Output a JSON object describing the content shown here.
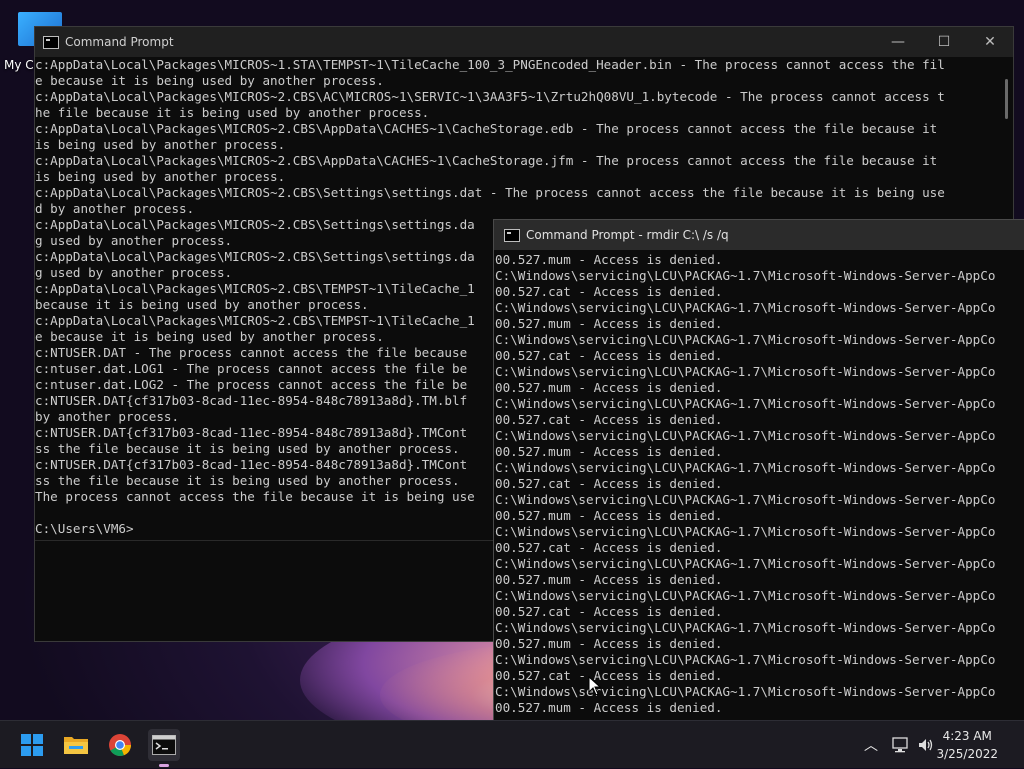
{
  "desktop": {
    "icon_label": "My Co"
  },
  "window_back": {
    "title": "Command Prompt",
    "controls": {
      "minimize": "—",
      "maximize": "☐",
      "close": "✕"
    },
    "lines": [
      "c:AppData\\Local\\Packages\\MICROS~1.STA\\TEMPST~1\\TileCache_100_3_PNGEncoded_Header.bin - The process cannot access the fil",
      "e because it is being used by another process.",
      "c:AppData\\Local\\Packages\\MICROS~2.CBS\\AC\\MICROS~1\\SERVIC~1\\3AA3F5~1\\Zrtu2hQ08VU_1.bytecode - The process cannot access t",
      "he file because it is being used by another process.",
      "c:AppData\\Local\\Packages\\MICROS~2.CBS\\AppData\\CACHES~1\\CacheStorage.edb - The process cannot access the file because it",
      "is being used by another process.",
      "c:AppData\\Local\\Packages\\MICROS~2.CBS\\AppData\\CACHES~1\\CacheStorage.jfm - The process cannot access the file because it",
      "is being used by another process.",
      "c:AppData\\Local\\Packages\\MICROS~2.CBS\\Settings\\settings.dat - The process cannot access the file because it is being use",
      "d by another process.",
      "c:AppData\\Local\\Packages\\MICROS~2.CBS\\Settings\\settings.da",
      "g used by another process.",
      "c:AppData\\Local\\Packages\\MICROS~2.CBS\\Settings\\settings.da",
      "g used by another process.",
      "c:AppData\\Local\\Packages\\MICROS~2.CBS\\TEMPST~1\\TileCache_1",
      "because it is being used by another process.",
      "c:AppData\\Local\\Packages\\MICROS~2.CBS\\TEMPST~1\\TileCache_1",
      "e because it is being used by another process.",
      "c:NTUSER.DAT - The process cannot access the file because",
      "c:ntuser.dat.LOG1 - The process cannot access the file be",
      "c:ntuser.dat.LOG2 - The process cannot access the file be",
      "c:NTUSER.DAT{cf317b03-8cad-11ec-8954-848c78913a8d}.TM.blf",
      "by another process.",
      "c:NTUSER.DAT{cf317b03-8cad-11ec-8954-848c78913a8d}.TMCont",
      "ss the file because it is being used by another process.",
      "c:NTUSER.DAT{cf317b03-8cad-11ec-8954-848c78913a8d}.TMCont",
      "ss the file because it is being used by another process.",
      "The process cannot access the file because it is being use",
      "",
      "C:\\Users\\VM6>"
    ]
  },
  "window_front": {
    "title": "Command Prompt - rmdir  C:\\ /s /q",
    "lines": [
      "00.527.mum - Access is denied.",
      "C:\\Windows\\servicing\\LCU\\PACKAG~1.7\\Microsoft-Windows-Server-AppCo",
      "00.527.cat - Access is denied.",
      "C:\\Windows\\servicing\\LCU\\PACKAG~1.7\\Microsoft-Windows-Server-AppCo",
      "00.527.mum - Access is denied.",
      "C:\\Windows\\servicing\\LCU\\PACKAG~1.7\\Microsoft-Windows-Server-AppCo",
      "00.527.cat - Access is denied.",
      "C:\\Windows\\servicing\\LCU\\PACKAG~1.7\\Microsoft-Windows-Server-AppCo",
      "00.527.mum - Access is denied.",
      "C:\\Windows\\servicing\\LCU\\PACKAG~1.7\\Microsoft-Windows-Server-AppCo",
      "00.527.cat - Access is denied.",
      "C:\\Windows\\servicing\\LCU\\PACKAG~1.7\\Microsoft-Windows-Server-AppCo",
      "00.527.mum - Access is denied.",
      "C:\\Windows\\servicing\\LCU\\PACKAG~1.7\\Microsoft-Windows-Server-AppCo",
      "00.527.cat - Access is denied.",
      "C:\\Windows\\servicing\\LCU\\PACKAG~1.7\\Microsoft-Windows-Server-AppCo",
      "00.527.mum - Access is denied.",
      "C:\\Windows\\servicing\\LCU\\PACKAG~1.7\\Microsoft-Windows-Server-AppCo",
      "00.527.cat - Access is denied.",
      "C:\\Windows\\servicing\\LCU\\PACKAG~1.7\\Microsoft-Windows-Server-AppCo",
      "00.527.mum - Access is denied.",
      "C:\\Windows\\servicing\\LCU\\PACKAG~1.7\\Microsoft-Windows-Server-AppCo",
      "00.527.cat - Access is denied.",
      "C:\\Windows\\servicing\\LCU\\PACKAG~1.7\\Microsoft-Windows-Server-AppCo",
      "00.527.mum - Access is denied.",
      "C:\\Windows\\servicing\\LCU\\PACKAG~1.7\\Microsoft-Windows-Server-AppCo",
      "00.527.cat - Access is denied.",
      "C:\\Windows\\servicing\\LCU\\PACKAG~1.7\\Microsoft-Windows-Server-AppCo",
      "00.527.mum - Access is denied."
    ]
  },
  "taskbar": {
    "icons": [
      "start-icon",
      "file-explorer-icon",
      "chrome-icon",
      "command-prompt-icon"
    ],
    "tray_chevron": "︿",
    "time": "4:23 AM",
    "date": "3/25/2022"
  },
  "colors": {
    "console_bg": "#0c0c0c",
    "console_text": "#cccccc",
    "titlebar_bg": "#202020",
    "taskbar_bg": "#1c1b22",
    "windows_blue": "#2c9cf0",
    "folder_yellow": "#f4c542"
  }
}
